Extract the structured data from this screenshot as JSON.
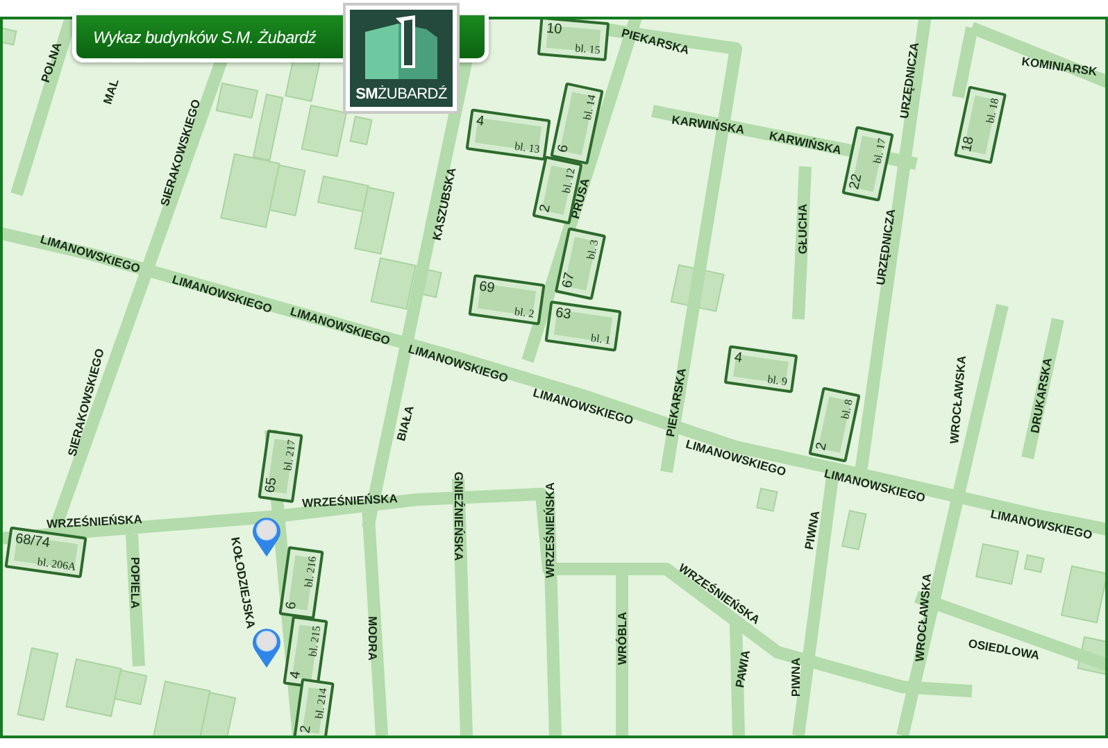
{
  "banner": {
    "title": "Wykaz budynków S.M. Żubardź"
  },
  "logo": {
    "text": "**SM**ŻUBARDŹ"
  },
  "streets": [
    {
      "name": "POLNA"
    },
    {
      "name": "MAL"
    },
    {
      "name": "SIERAKOWSKIEGO"
    },
    {
      "name": "KASZUBSKA"
    },
    {
      "name": "PIEKARSKA"
    },
    {
      "name": "KARWIŃSKA"
    },
    {
      "name": "KARWIŃSKA"
    },
    {
      "name": "URZĘDNICZA"
    },
    {
      "name": "URZĘDNICZA"
    },
    {
      "name": "KOMINIARSK"
    },
    {
      "name": "PRUSA"
    },
    {
      "name": "GŁUCHA"
    },
    {
      "name": "LIMANOWSKIEGO"
    },
    {
      "name": "LIMANOWSKIEGO"
    },
    {
      "name": "LIMANOWSKIEGO"
    },
    {
      "name": "LIMANOWSKIEGO"
    },
    {
      "name": "LIMANOWSKIEGO"
    },
    {
      "name": "LIMANOWSKIEGO"
    },
    {
      "name": "LIMANOWSKIEGO"
    },
    {
      "name": "LIMANOWSKIEGO"
    },
    {
      "name": "SIERAKOWSKIEGO"
    },
    {
      "name": "BIAŁA"
    },
    {
      "name": "PIEKARSKA"
    },
    {
      "name": "WROCŁAWSKA"
    },
    {
      "name": "DRUKARSKA"
    },
    {
      "name": "WRZEŚNIEŃSKA"
    },
    {
      "name": "WRZEŚNIEŃSKA"
    },
    {
      "name": "GNIEŹNIEŃSKA"
    },
    {
      "name": "WRZEŚNIEŃSKA"
    },
    {
      "name": "WRZEŚNIEŃSKA"
    },
    {
      "name": "KOŁODZIEJSKA"
    },
    {
      "name": "POPIELA"
    },
    {
      "name": "MODRA"
    },
    {
      "name": "WRÓBLA"
    },
    {
      "name": "PAWIA"
    },
    {
      "name": "PIWNA"
    },
    {
      "name": "PIWNA"
    },
    {
      "name": "WROCŁAWSKA"
    },
    {
      "name": "OSIEDLOWA"
    }
  ],
  "buildings": [
    {
      "number": "10",
      "block": "bl. 15"
    },
    {
      "number": "4",
      "block": "bl. 13"
    },
    {
      "number": "6",
      "block": "bl. 14"
    },
    {
      "number": "2",
      "block": "bl. 12"
    },
    {
      "number": "67",
      "block": "bl. 3"
    },
    {
      "number": "69",
      "block": "bl. 2"
    },
    {
      "number": "63",
      "block": "bl. 1"
    },
    {
      "number": "22",
      "block": "bl. 17"
    },
    {
      "number": "18",
      "block": "bl. 18"
    },
    {
      "number": "4",
      "block": "bl. 9"
    },
    {
      "number": "2",
      "block": "bl. 8"
    },
    {
      "number": "65",
      "block": "bl. 217"
    },
    {
      "number": "68/74",
      "block": "bl. 206A"
    },
    {
      "number": "6",
      "block": "bl. 216"
    },
    {
      "number": "4",
      "block": "bl. 215"
    },
    {
      "number": "2",
      "block": "bl. 214"
    }
  ]
}
